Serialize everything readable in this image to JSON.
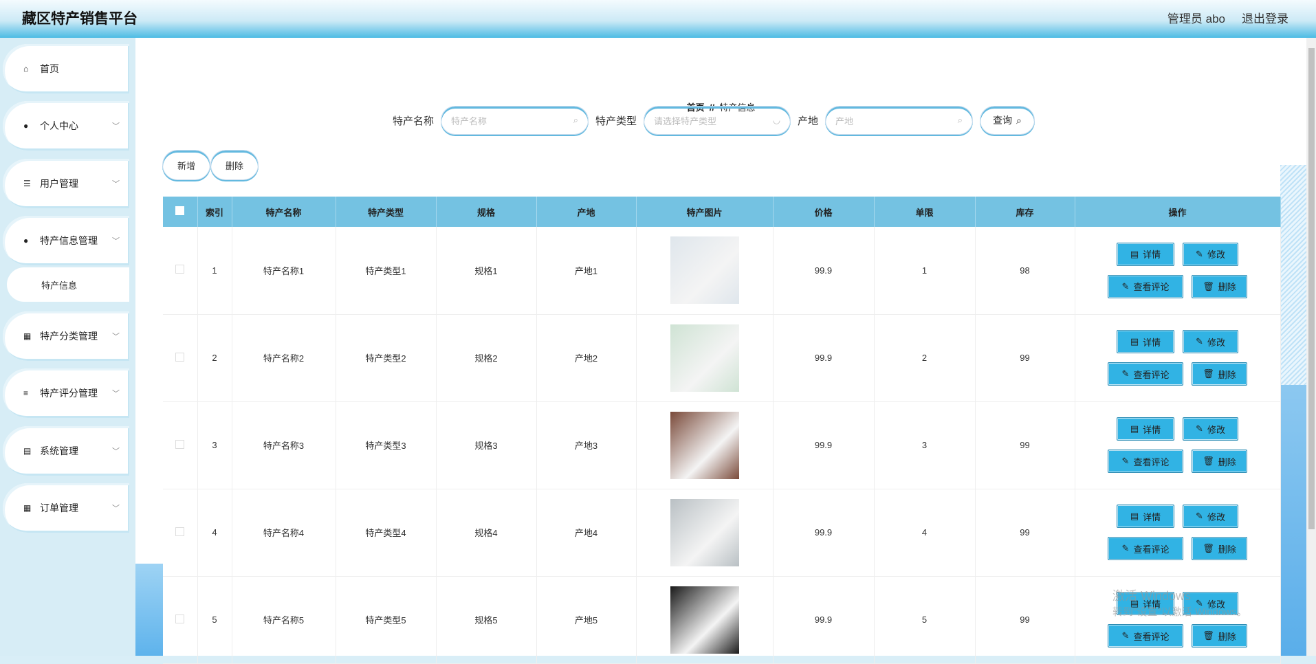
{
  "header": {
    "title": "藏区特产销售平台",
    "user": "管理员 abo",
    "logout": "退出登录"
  },
  "sidebar": {
    "items": [
      {
        "label": "首页",
        "icon": "home-icon",
        "glyph": "⌂"
      },
      {
        "label": "个人中心",
        "icon": "user-icon",
        "glyph": "●"
      },
      {
        "label": "用户管理",
        "icon": "list-icon",
        "glyph": "☰"
      },
      {
        "label": "特产信息管理",
        "icon": "user-icon",
        "glyph": "●"
      },
      {
        "label": "特产分类管理",
        "icon": "grid-icon",
        "glyph": "▦"
      },
      {
        "label": "特产评分管理",
        "icon": "sliders-icon",
        "glyph": "≡"
      },
      {
        "label": "系统管理",
        "icon": "clipboard-icon",
        "glyph": "▤"
      },
      {
        "label": "订单管理",
        "icon": "grid-icon",
        "glyph": "▦"
      }
    ],
    "sub": "特产信息"
  },
  "breadcrumb": {
    "home": "首页",
    "sep": "//",
    "current": "特产信息"
  },
  "search": {
    "name_label": "特产名称",
    "name_placeholder": "特产名称",
    "type_label": "特产类型",
    "type_placeholder": "请选择特产类型",
    "origin_label": "产地",
    "origin_placeholder": "产地",
    "query": "查询"
  },
  "actions": {
    "add": "新增",
    "delete": "删除"
  },
  "table": {
    "headers": [
      "索引",
      "特产名称",
      "特产类型",
      "规格",
      "产地",
      "特产图片",
      "价格",
      "单限",
      "库存",
      "操作"
    ],
    "rows": [
      {
        "idx": "1",
        "name": "特产名称1",
        "type": "特产类型1",
        "spec": "规格1",
        "origin": "产地1",
        "price": "99.9",
        "limit": "1",
        "stock": "98",
        "img": "#dfe6ec"
      },
      {
        "idx": "2",
        "name": "特产名称2",
        "type": "特产类型2",
        "spec": "规格2",
        "origin": "产地2",
        "price": "99.9",
        "limit": "2",
        "stock": "99",
        "img": "#cfe3d4"
      },
      {
        "idx": "3",
        "name": "特产名称3",
        "type": "特产类型3",
        "spec": "规格3",
        "origin": "产地3",
        "price": "99.9",
        "limit": "3",
        "stock": "99",
        "img": "#7a4a3a"
      },
      {
        "idx": "4",
        "name": "特产名称4",
        "type": "特产类型4",
        "spec": "规格4",
        "origin": "产地4",
        "price": "99.9",
        "limit": "4",
        "stock": "99",
        "img": "#b9c0c4"
      },
      {
        "idx": "5",
        "name": "特产名称5",
        "type": "特产类型5",
        "spec": "规格5",
        "origin": "产地5",
        "price": "99.9",
        "limit": "5",
        "stock": "99",
        "img": "#1a1a1a"
      }
    ],
    "ops": {
      "detail": "详情",
      "edit": "修改",
      "comments": "查看评论",
      "delete": "删除"
    }
  },
  "watermark": {
    "line1": "激活 Windows",
    "line2": "转到\"设置\"以激活 Windows。"
  }
}
